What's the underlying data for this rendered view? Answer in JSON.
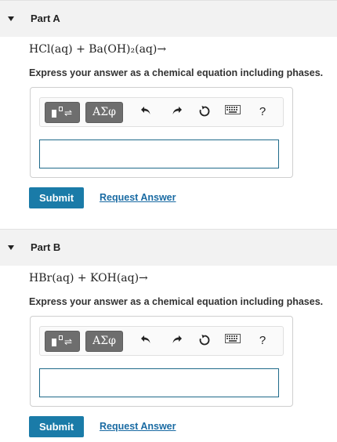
{
  "parts": [
    {
      "title": "Part A",
      "equation": "HCl(aq) + Ba(OH)₂(aq)→",
      "instruction": "Express your answer as a chemical equation including phases.",
      "toolbar": {
        "greek_label": "ΑΣφ",
        "help_label": "?"
      },
      "answer_value": "",
      "submit_label": "Submit",
      "request_label": "Request Answer"
    },
    {
      "title": "Part B",
      "equation": "HBr(aq) + KOH(aq)→",
      "instruction": "Express your answer as a chemical equation including phases.",
      "toolbar": {
        "greek_label": "ΑΣφ",
        "help_label": "?"
      },
      "answer_value": "",
      "submit_label": "Submit",
      "request_label": "Request Answer"
    }
  ],
  "colors": {
    "accent": "#1a7ba8",
    "link": "#1a6ba3",
    "header_bg": "#f2f2f2"
  }
}
